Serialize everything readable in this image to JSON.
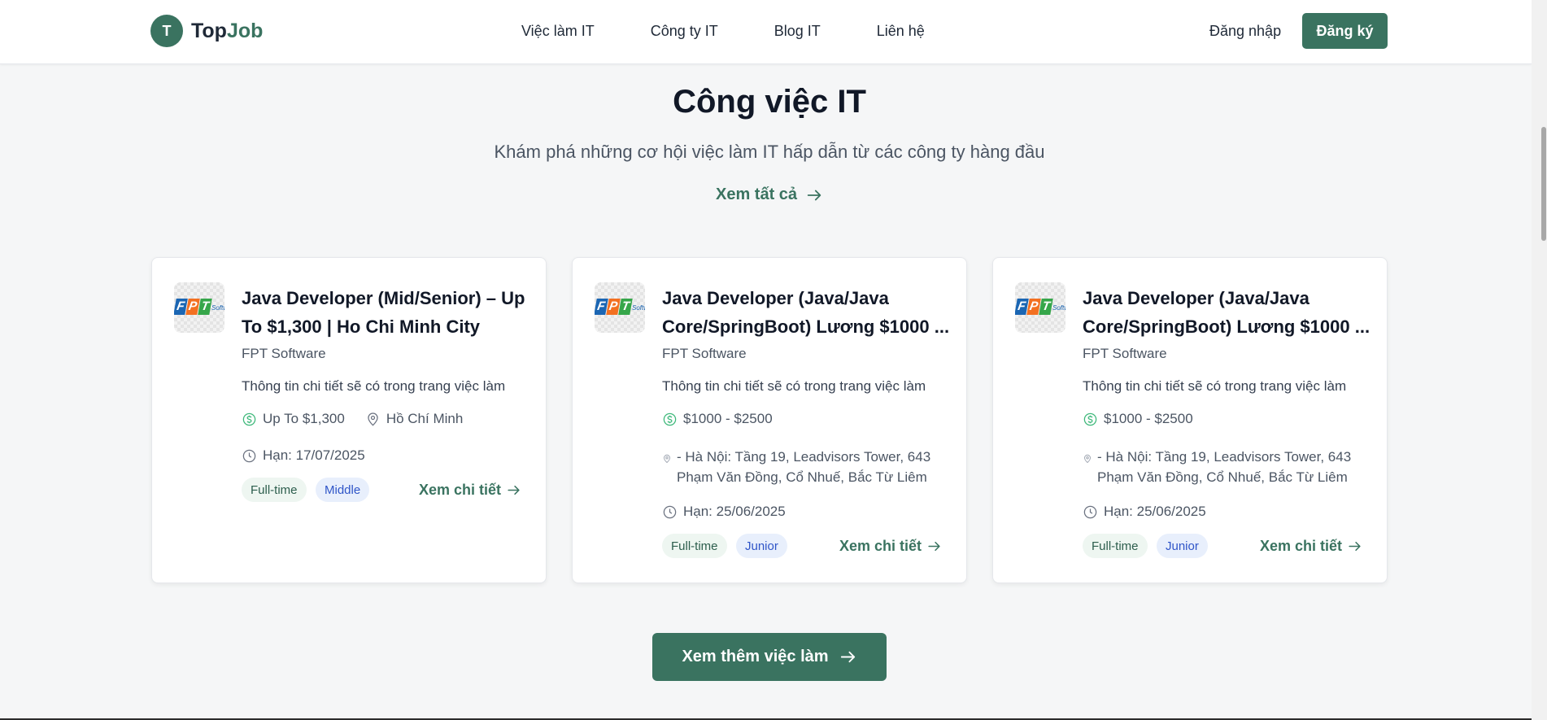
{
  "header": {
    "logo_letter": "T",
    "logo_part1": "Top",
    "logo_part2": "Job",
    "nav": [
      "Việc làm IT",
      "Công ty IT",
      "Blog IT",
      "Liên hệ"
    ],
    "login": "Đăng nhập",
    "signup": "Đăng ký"
  },
  "section": {
    "title": "Công việc IT",
    "subtitle": "Khám phá những cơ hội việc làm IT hấp dẫn từ các công ty hàng đầu",
    "view_all": "Xem tất cả"
  },
  "jobs": [
    {
      "logo_letters": [
        "F",
        "P",
        "T"
      ],
      "logo_sub": "Softw",
      "title": "Java Developer (Mid/Senior) – Up To $1,300 | Ho Chi Minh City",
      "company": "FPT Software",
      "description": "Thông tin chi tiết sẽ có trong trang việc làm",
      "salary": "Up To $1,300",
      "location": "Hồ Chí Minh",
      "deadline": "Hạn: 17/07/2025",
      "type": "Full-time",
      "level": "Middle",
      "detail": "Xem chi tiết"
    },
    {
      "logo_letters": [
        "F",
        "P",
        "T"
      ],
      "logo_sub": "Softw",
      "title": "Java Developer (Java/Java Core/SpringBoot) Lương $1000 ...",
      "company": "FPT Software",
      "description": "Thông tin chi tiết sẽ có trong trang việc làm",
      "salary": "$1000 - $2500",
      "location": "- Hà Nội: Tầng 19, Leadvisors Tower, 643 Phạm Văn Đồng, Cổ Nhuế, Bắc Từ Liêm",
      "deadline": "Hạn: 25/06/2025",
      "type": "Full-time",
      "level": "Junior",
      "detail": "Xem chi tiết"
    },
    {
      "logo_letters": [
        "F",
        "P",
        "T"
      ],
      "logo_sub": "Softw",
      "title": "Java Developer (Java/Java Core/SpringBoot) Lương $1000 ...",
      "company": "FPT Software",
      "description": "Thông tin chi tiết sẽ có trong trang việc làm",
      "salary": "$1000 - $2500",
      "location": "- Hà Nội: Tầng 19, Leadvisors Tower, 643 Phạm Văn Đồng, Cổ Nhuế, Bắc Từ Liêm",
      "deadline": "Hạn: 25/06/2025",
      "type": "Full-time",
      "level": "Junior",
      "detail": "Xem chi tiết"
    }
  ],
  "more_button": "Xem thêm việc làm",
  "colors": {
    "primary": "#3a7360",
    "background": "#f5f6f7",
    "fpt_blue": "#1b66b3",
    "fpt_orange": "#f37021",
    "fpt_green": "#36a64a"
  }
}
